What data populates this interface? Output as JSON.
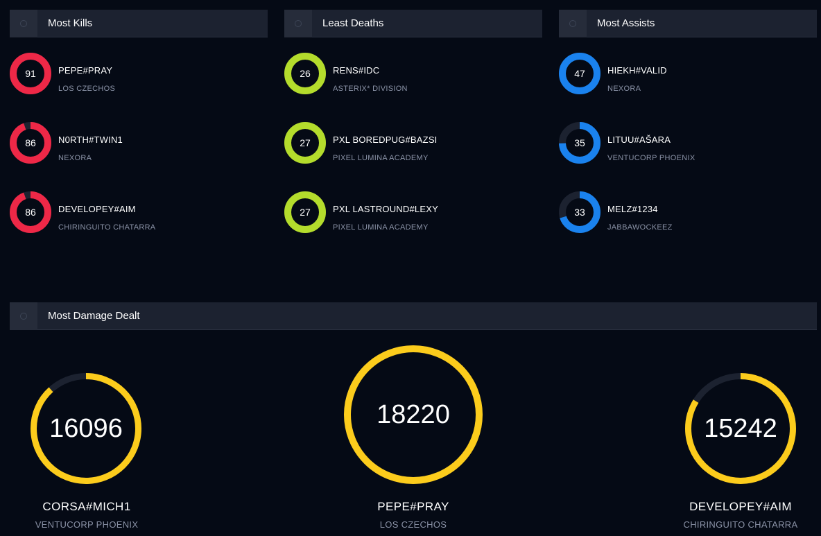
{
  "colors": {
    "kills": "#ee2847",
    "deaths": "#b4dc2c",
    "assists": "#1a82ee",
    "damage": "#fccc1c",
    "track": "#1c2230"
  },
  "panels": [
    {
      "key": "kills",
      "title": "Most Kills",
      "icon": "circle-icon",
      "color": "#ee2847",
      "entries": [
        {
          "value": "91",
          "fill": 1.0,
          "name": "PEPE#PRAY",
          "team": "LOS CZECHOS"
        },
        {
          "value": "86",
          "fill": 0.945,
          "name": "N0RTH#TWIN1",
          "team": "NEXORA"
        },
        {
          "value": "86",
          "fill": 0.945,
          "name": "DEVELOPEY#AIM",
          "team": "CHIRINGUITO CHATARRA"
        }
      ]
    },
    {
      "key": "deaths",
      "title": "Least Deaths",
      "icon": "circle-icon",
      "color": "#b4dc2c",
      "entries": [
        {
          "value": "26",
          "fill": 1.0,
          "name": "RENS#IDC",
          "team": "ASTERIX* DIVISION"
        },
        {
          "value": "27",
          "fill": 1.0,
          "name": "PXL BOREDPUG#BAZSI",
          "team": "PIXEL LUMINA ACADEMY"
        },
        {
          "value": "27",
          "fill": 1.0,
          "name": "PXL LASTROUND#LEXY",
          "team": "PIXEL LUMINA ACADEMY"
        }
      ]
    },
    {
      "key": "assists",
      "title": "Most Assists",
      "icon": "circle-icon",
      "color": "#1a82ee",
      "entries": [
        {
          "value": "47",
          "fill": 1.0,
          "name": "HIEKH#VALID",
          "team": "NEXORA"
        },
        {
          "value": "35",
          "fill": 0.745,
          "name": "LITUU#AŠARA",
          "team": "VENTUCORP PHOENIX"
        },
        {
          "value": "33",
          "fill": 0.702,
          "name": "MELZ#1234",
          "team": "JABBAWOCKEEZ"
        }
      ]
    }
  ],
  "damage": {
    "title": "Most Damage Dealt",
    "icon": "circle-icon",
    "color": "#fccc1c",
    "entries": [
      {
        "value": "16096",
        "fill": 0.883,
        "name": "CORSA#MICH1",
        "team": "VENTUCORP PHOENIX"
      },
      {
        "value": "18220",
        "fill": 1.0,
        "name": "PEPE#PRAY",
        "team": "LOS CZECHOS"
      },
      {
        "value": "15242",
        "fill": 0.837,
        "name": "DEVELOPEY#AIM",
        "team": "CHIRINGUITO CHATARRA"
      }
    ]
  }
}
